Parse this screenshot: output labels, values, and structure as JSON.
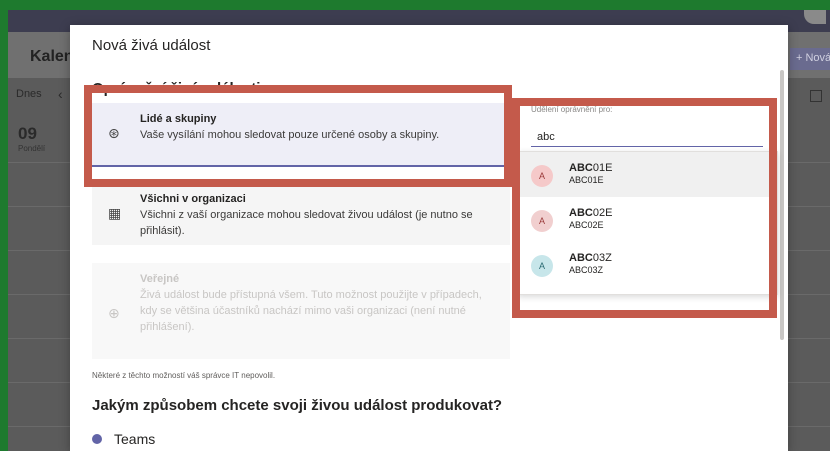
{
  "app": {
    "title": "Kalendář",
    "nav_today": "Dnes",
    "date_number": "09",
    "date_day": "Pondělí",
    "new_button": "+ Nová"
  },
  "dialog": {
    "title": "Nová živá událost",
    "section_title": "Oprávnění živé události",
    "options": [
      {
        "icon": "people-group-icon",
        "title": "Lidé a skupiny",
        "description": "Vaše vysílání mohou sledovat pouze určené osoby a skupiny.",
        "selected": true,
        "disabled": false
      },
      {
        "icon": "building-icon",
        "title": "Všichni v organizaci",
        "description": "Všichni z vaší organizace mohou sledovat živou událost (je nutno se přihlásit).",
        "selected": false,
        "disabled": false
      },
      {
        "icon": "globe-icon",
        "title": "Veřejné",
        "description": "Živá událost bude přístupná všem. Tuto možnost použijte v případech, kdy se většina účastníků nachází mimo vaši organizaci (není nutné přihlášení).",
        "selected": false,
        "disabled": true
      }
    ],
    "admin_note": "Některé z těchto možností váš správce IT nepovolil.",
    "produce_title": "Jakým způsobem chcete svoji živou událost produkovat?",
    "produce_option": "Teams"
  },
  "grant": {
    "label": "Udělení oprávnění pro:",
    "input_value": "abc",
    "suggestions": [
      {
        "initial": "A",
        "name_match": "ABC",
        "name_rest": "01E",
        "sub": "ABC01E",
        "highlighted": true
      },
      {
        "initial": "A",
        "name_match": "ABC",
        "name_rest": "02E",
        "sub": "ABC02E",
        "highlighted": false
      },
      {
        "initial": "A",
        "name_match": "ABC",
        "name_rest": "03Z",
        "sub": "ABC03Z",
        "highlighted": false
      }
    ]
  },
  "colors": {
    "accent": "#6264a7",
    "annotation": "#c45a4b",
    "frame": "#1e7a2e"
  }
}
